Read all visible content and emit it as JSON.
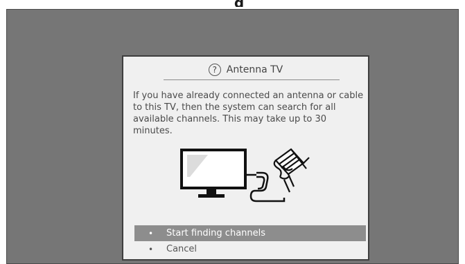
{
  "screen": {
    "heading_fragment": "g"
  },
  "dialog": {
    "title": "Antenna TV",
    "help_icon": "?",
    "body": "If you have already connected an antenna or cable to this TV, then the system can search for all available channels. This may take up to 30 minutes.",
    "illustration_icon": "tv-antenna-illustration",
    "options": [
      {
        "bullet": "•",
        "label": "Start finding channels",
        "selected": true
      },
      {
        "bullet": "•",
        "label": "Cancel",
        "selected": false
      }
    ]
  },
  "colors": {
    "background": "#767676",
    "dialog_bg": "#f0f0f0",
    "selected_bg": "#8d8d8d"
  }
}
